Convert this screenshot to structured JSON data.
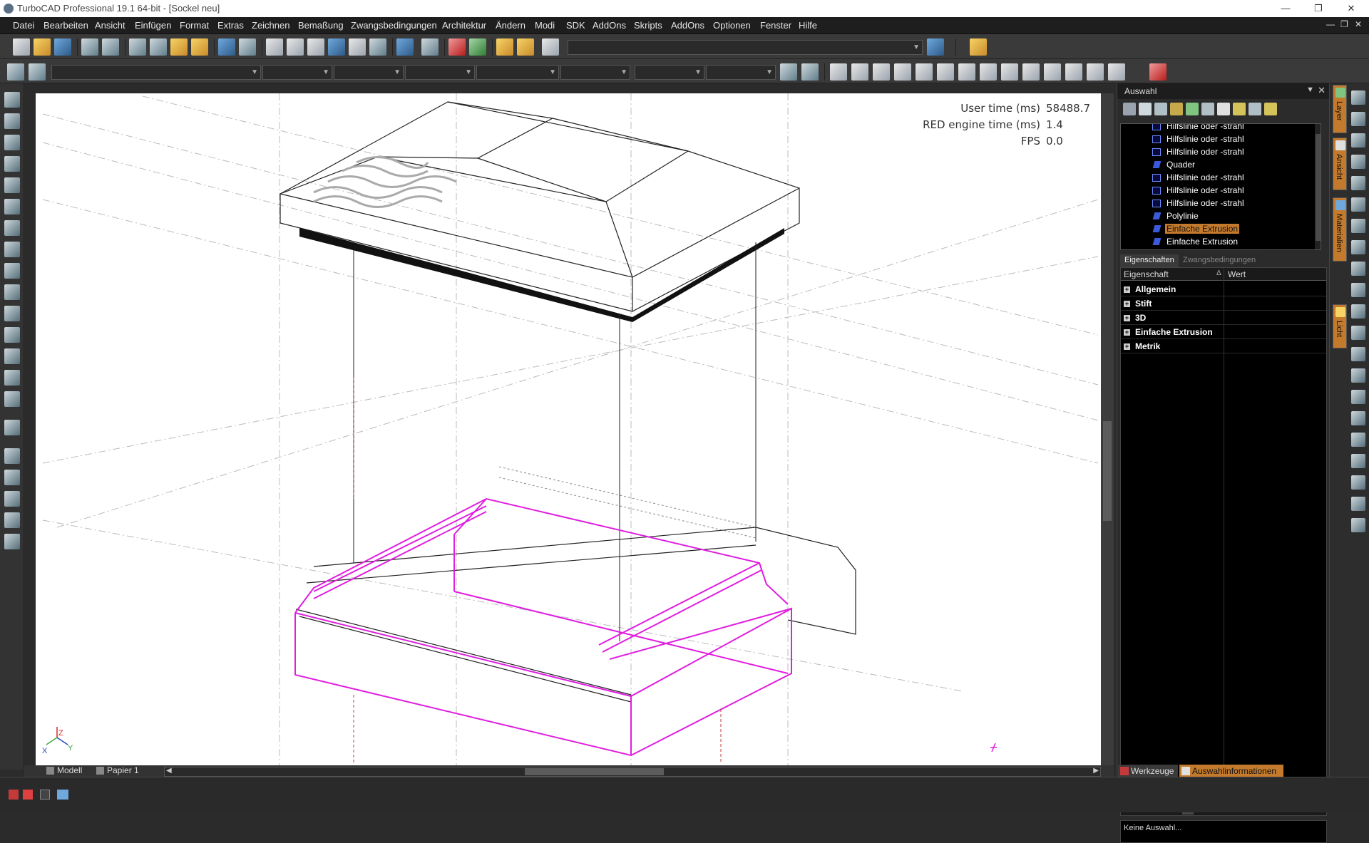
{
  "window": {
    "title": "TurboCAD Professional 19.1 64-bit - [Sockel neu]",
    "controls": [
      "—",
      "❐",
      "✕"
    ],
    "mdi_controls": [
      "—",
      "❐",
      "✕"
    ]
  },
  "menu": [
    "Datei",
    "Bearbeiten",
    "Ansicht",
    "Einfügen",
    "Format",
    "Extras",
    "Zeichnen",
    "Bemaßung",
    "Zwangsbedingungen",
    "Architektur",
    "Ändern",
    "Modi",
    "SDK",
    "AddOns",
    "Skripts",
    "AddOns",
    "Optionen",
    "Fenster",
    "Hilfe"
  ],
  "viewport": {
    "stats": [
      {
        "label": "User time (ms)",
        "value": "58488.7"
      },
      {
        "label": "RED engine time (ms)",
        "value": "1.4"
      },
      {
        "label": "FPS",
        "value": "0.0"
      }
    ],
    "axis_labels": {
      "x": "X",
      "y": "Y",
      "z": "Z"
    },
    "selection_color": "#e01ee0"
  },
  "layout_tabs": [
    {
      "label": "Modell",
      "icon": "model-icon"
    },
    {
      "label": "Papier 1",
      "icon": "paper-icon"
    }
  ],
  "selection_panel": {
    "title": "Auswahl",
    "tree_items": [
      {
        "label": "Hilfslinie oder -strahl",
        "icon": "line-icon",
        "selected": false
      },
      {
        "label": "Hilfslinie oder -strahl",
        "icon": "line-icon",
        "selected": false
      },
      {
        "label": "Hilfslinie oder -strahl",
        "icon": "line-icon",
        "selected": false
      },
      {
        "label": "Quader",
        "icon": "box-icon",
        "selected": false
      },
      {
        "label": "Hilfslinie oder -strahl",
        "icon": "line-icon",
        "selected": false
      },
      {
        "label": "Hilfslinie oder -strahl",
        "icon": "line-icon",
        "selected": false
      },
      {
        "label": "Hilfslinie oder -strahl",
        "icon": "line-icon",
        "selected": false
      },
      {
        "label": "Polylinie",
        "icon": "polyline-icon",
        "selected": false
      },
      {
        "label": "Einfache Extrusion",
        "icon": "extrusion-icon",
        "selected": true
      },
      {
        "label": "Einfache Extrusion",
        "icon": "extrusion-icon",
        "selected": false
      }
    ],
    "tabs": [
      {
        "label": "Eigenschaften",
        "active": true
      },
      {
        "label": "Zwangsbedingungen",
        "active": false
      }
    ],
    "grid_headers": {
      "property": "Eigenschaft",
      "value": "Wert"
    },
    "categories": [
      "Allgemein",
      "Stift",
      "3D",
      "Einfache Extrusion",
      "Metrik"
    ],
    "info_text": "Keine Auswahl..."
  },
  "bottom_right_tabs": [
    {
      "label": "Werkzeuge",
      "icon": "tools-icon"
    },
    {
      "label": "Auswahlinformationen",
      "icon": "info-icon"
    }
  ],
  "side_tabs": [
    {
      "label": "Layer",
      "active": true
    },
    {
      "label": "Ansicht",
      "active": true
    },
    {
      "label": "Materialien",
      "active": true
    },
    {
      "label": "Licht",
      "active": true
    }
  ]
}
